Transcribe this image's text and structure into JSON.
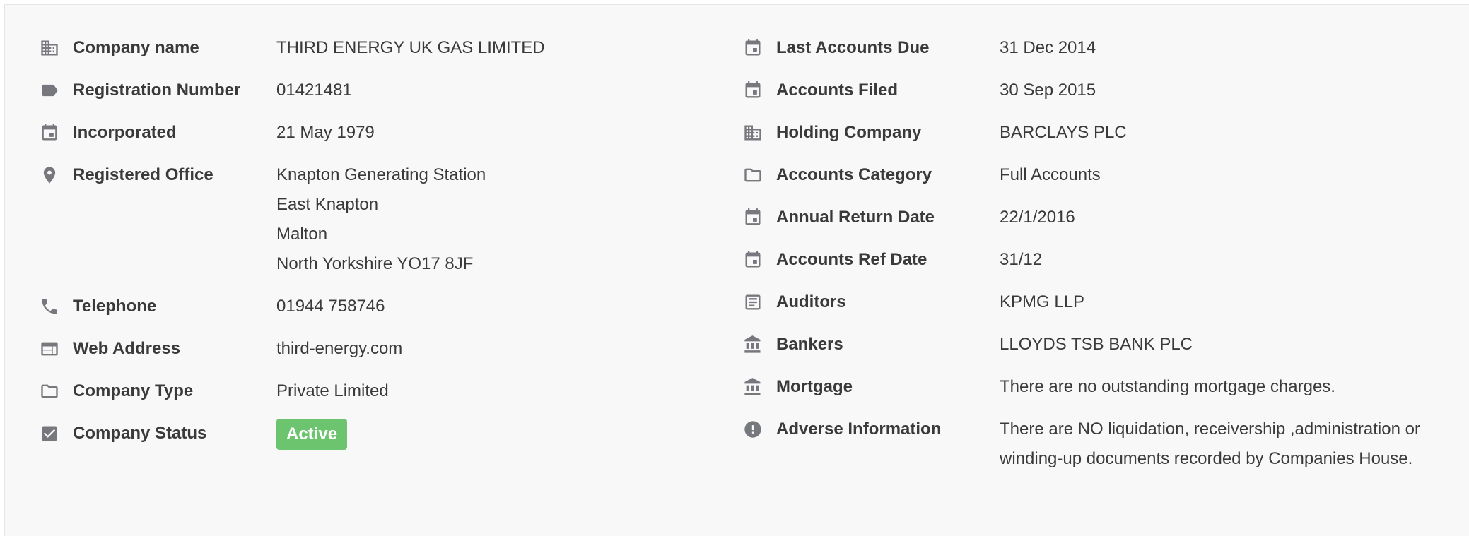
{
  "left": [
    {
      "icon": "building-icon",
      "label": "Company name",
      "value": "THIRD ENERGY UK GAS LIMITED"
    },
    {
      "icon": "tag-icon",
      "label": "Registration Number",
      "value": "01421481"
    },
    {
      "icon": "calendar-icon",
      "label": "Incorporated",
      "value": "21 May 1979"
    },
    {
      "icon": "map-pin-icon",
      "label": "Registered Office",
      "lines": [
        "Knapton Generating Station",
        "East Knapton",
        "Malton",
        "North Yorkshire YO17 8JF"
      ]
    },
    {
      "icon": "phone-icon",
      "label": "Telephone",
      "value": "01944 758746"
    },
    {
      "icon": "web-icon",
      "label": "Web Address",
      "value": "third-energy.com"
    },
    {
      "icon": "folder-icon",
      "label": "Company Type",
      "value": "Private Limited"
    },
    {
      "icon": "checkbox-icon",
      "label": "Company Status",
      "badge": "Active"
    }
  ],
  "right": [
    {
      "icon": "calendar-icon",
      "label": "Last Accounts Due",
      "value": "31 Dec 2014"
    },
    {
      "icon": "calendar-icon",
      "label": "Accounts Filed",
      "value": "30 Sep 2015"
    },
    {
      "icon": "building-icon",
      "label": "Holding Company",
      "value": "BARCLAYS PLC"
    },
    {
      "icon": "folder-icon",
      "label": "Accounts Category",
      "value": "Full Accounts"
    },
    {
      "icon": "calendar-icon",
      "label": "Annual Return Date",
      "value": "22/1/2016"
    },
    {
      "icon": "calendar-icon",
      "label": "Accounts Ref Date",
      "value": "31/12"
    },
    {
      "icon": "document-icon",
      "label": "Auditors",
      "value": "KPMG LLP"
    },
    {
      "icon": "bank-icon",
      "label": "Bankers",
      "value": "LLOYDS TSB BANK PLC"
    },
    {
      "icon": "bank-icon",
      "label": "Mortgage",
      "value": "There are no outstanding mortgage charges."
    },
    {
      "icon": "alert-icon",
      "label": "Adverse Information",
      "value": "There are NO liquidation, receivership ,administration or winding-up documents recorded by Companies House."
    }
  ],
  "colors": {
    "badge": "#6cc46f",
    "icon": "#77787d",
    "text": "#3a3a3a"
  }
}
